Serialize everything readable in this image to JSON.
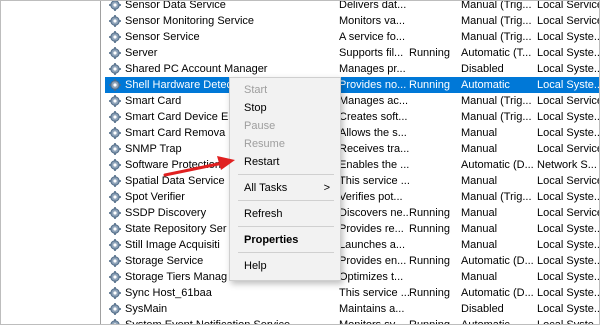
{
  "services": [
    {
      "name": "Sensor Data Service",
      "description": "Delivers dat...",
      "status": "",
      "startup": "Manual (Trig...",
      "logon": "Local Service"
    },
    {
      "name": "Sensor Monitoring Service",
      "description": "Monitors va...",
      "status": "",
      "startup": "Manual (Trig...",
      "logon": "Local Service"
    },
    {
      "name": "Sensor Service",
      "description": "A service fo...",
      "status": "",
      "startup": "Manual (Trig...",
      "logon": "Local Syste..."
    },
    {
      "name": "Server",
      "description": "Supports fil...",
      "status": "Running",
      "startup": "Automatic (T...",
      "logon": "Local Syste..."
    },
    {
      "name": "Shared PC Account Manager",
      "description": "Manages pr...",
      "status": "",
      "startup": "Disabled",
      "logon": "Local Syste..."
    },
    {
      "name": "Shell Hardware Detecti",
      "description": "Provides no...",
      "status": "Running",
      "startup": "Automatic",
      "logon": "Local Syste..."
    },
    {
      "name": "Smart Card",
      "description": "Manages ac...",
      "status": "",
      "startup": "Manual (Trig...",
      "logon": "Local Service"
    },
    {
      "name": "Smart Card Device E",
      "description": "Creates soft...",
      "status": "",
      "startup": "Manual (Trig...",
      "logon": "Local Syste..."
    },
    {
      "name": "Smart Card Remova",
      "description": "Allows the s...",
      "status": "",
      "startup": "Manual",
      "logon": "Local Syste..."
    },
    {
      "name": "SNMP Trap",
      "description": "Receives tra...",
      "status": "",
      "startup": "Manual",
      "logon": "Local Service"
    },
    {
      "name": "Software Protection",
      "description": "Enables the ...",
      "status": "",
      "startup": "Automatic (D...",
      "logon": "Network S..."
    },
    {
      "name": "Spatial Data Service",
      "description": "This service ...",
      "status": "",
      "startup": "Manual",
      "logon": "Local Service"
    },
    {
      "name": "Spot Verifier",
      "description": "Verifies pot...",
      "status": "",
      "startup": "Manual (Trig...",
      "logon": "Local Syste..."
    },
    {
      "name": "SSDP Discovery",
      "description": "Discovers ne...",
      "status": "Running",
      "startup": "Manual",
      "logon": "Local Service"
    },
    {
      "name": "State Repository Ser",
      "description": "Provides re...",
      "status": "Running",
      "startup": "Manual",
      "logon": "Local Syste..."
    },
    {
      "name": "Still Image Acquisiti",
      "description": "Launches a...",
      "status": "",
      "startup": "Manual",
      "logon": "Local Syste..."
    },
    {
      "name": "Storage Service",
      "description": "Provides en...",
      "status": "Running",
      "startup": "Automatic (D...",
      "logon": "Local Syste..."
    },
    {
      "name": "Storage Tiers Manag",
      "description": "Optimizes t...",
      "status": "",
      "startup": "Manual",
      "logon": "Local Syste..."
    },
    {
      "name": "Sync Host_61baa",
      "description": "This service ...",
      "status": "Running",
      "startup": "Automatic (D...",
      "logon": "Local Syste..."
    },
    {
      "name": "SysMain",
      "description": "Maintains a...",
      "status": "",
      "startup": "Disabled",
      "logon": "Local Syste..."
    },
    {
      "name": "System Event Notification Service",
      "description": "Monitors sy...",
      "status": "Running",
      "startup": "Automatic",
      "logon": "Local Syste..."
    }
  ],
  "selected_index": 5,
  "context_menu": {
    "start": "Start",
    "stop": "Stop",
    "pause": "Pause",
    "resume": "Resume",
    "restart": "Restart",
    "all_tasks": "All Tasks",
    "all_tasks_arrow": ">",
    "refresh": "Refresh",
    "properties": "Properties",
    "help": "Help"
  },
  "colors": {
    "selection": "#0078d7",
    "arrow": "#e02020"
  },
  "icons": {
    "service": "gear-icon",
    "pointer": "red-arrow-icon"
  }
}
